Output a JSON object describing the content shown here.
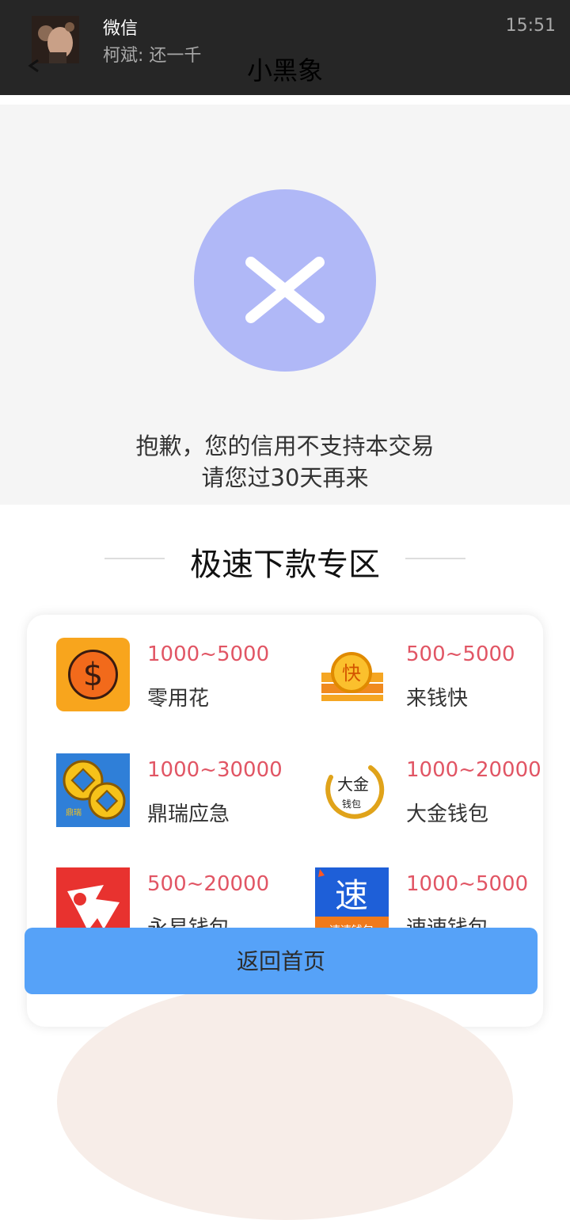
{
  "notification": {
    "app_name": "微信",
    "message": "柯斌: 还一千",
    "time": "15:51"
  },
  "header": {
    "title": "小黑象"
  },
  "error": {
    "line1": "抱歉，您的信用不支持本交易",
    "line2": "请您过30天再来"
  },
  "section": {
    "title": "极速下款专区"
  },
  "products": [
    {
      "amount": "1000~5000",
      "name": "零用花",
      "icon": "dollar-coin-icon"
    },
    {
      "amount": "500~5000",
      "name": "来钱快",
      "icon": "gold-coin-stack-icon"
    },
    {
      "amount": "1000~30000",
      "name": "鼎瑞应急",
      "icon": "copper-coins-icon"
    },
    {
      "amount": "1000~20000",
      "name": "大金钱包",
      "icon": "dajin-calligraphy-icon"
    },
    {
      "amount": "500~20000",
      "name": "永易钱包",
      "icon": "red-bird-icon"
    },
    {
      "amount": "1000~5000",
      "name": "速速钱包",
      "icon": "su-character-icon"
    }
  ],
  "logo_texts": {
    "dingrui": "鼎瑞",
    "fast": "快",
    "dajin_top": "大金",
    "dajin_bottom": "钱包",
    "su": "速",
    "su_sub": "速速钱包"
  },
  "actions": {
    "home_button": "返回首页"
  },
  "colors": {
    "notification_bg": "#262626",
    "error_circle": "#b0b8f7",
    "amount": "#e15564",
    "button": "#56a2f8"
  }
}
